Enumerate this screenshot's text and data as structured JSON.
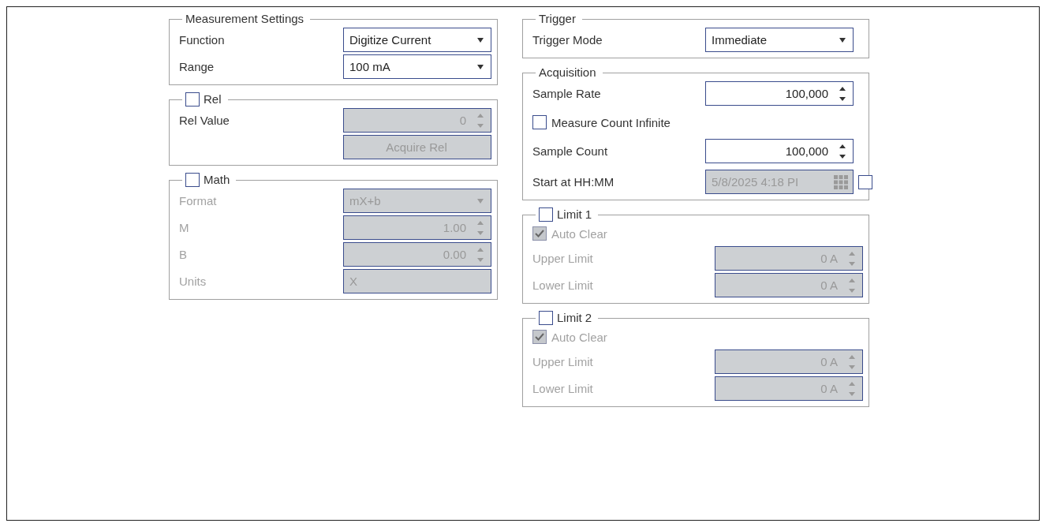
{
  "columns": [
    {
      "groups": [
        {
          "title": "Measurement Settings",
          "disabled": false,
          "rows": [
            {
              "kind": "select",
              "label": "Function",
              "value": "Digitize Current",
              "disabled": false
            },
            {
              "kind": "select",
              "label": "Range",
              "value": "100 mA",
              "disabled": false
            }
          ]
        },
        {
          "title": "Rel",
          "checkbox": {
            "checked": false
          },
          "disabled": false,
          "rows": [
            {
              "kind": "spin",
              "label": "Rel Value",
              "value": "0",
              "disabled": true
            },
            {
              "kind": "button",
              "text": "Acquire Rel",
              "disabled": true
            }
          ]
        },
        {
          "title": "Math",
          "checkbox": {
            "checked": false
          },
          "disabled": true,
          "rows": [
            {
              "kind": "select",
              "label": "Format",
              "value": "mX+b",
              "disabled": true
            },
            {
              "kind": "spin",
              "label": "M",
              "value": "1.00",
              "disabled": true
            },
            {
              "kind": "spin",
              "label": "B",
              "value": "0.00",
              "disabled": true
            },
            {
              "kind": "text",
              "label": "Units",
              "value": "X",
              "disabled": true
            }
          ]
        }
      ]
    },
    {
      "groups": [
        {
          "title": "Trigger",
          "disabled": false,
          "rows": [
            {
              "kind": "select",
              "label": "Trigger Mode",
              "value": "Immediate",
              "disabled": false
            }
          ]
        },
        {
          "title": "Acquisition",
          "disabled": false,
          "rows": [
            {
              "kind": "spin",
              "label": "Sample Rate",
              "value": "100,000",
              "disabled": false
            },
            {
              "kind": "check",
              "label": "Measure Count Infinite",
              "checked": false,
              "disabled": false
            },
            {
              "kind": "spin",
              "label": "Sample Count",
              "value": "100,000",
              "disabled": false
            },
            {
              "kind": "datetime",
              "label": "Start at HH:MM",
              "value": "5/8/2025 4:18 PI",
              "disabled": true,
              "checked": false
            }
          ]
        },
        {
          "title": "Limit 1",
          "checkbox": {
            "checked": false
          },
          "disabled": true,
          "rows": [
            {
              "kind": "check",
              "label": "Auto Clear",
              "checked": true,
              "disabled": true
            },
            {
              "kind": "spin",
              "label": "Upper Limit",
              "value": "0 A",
              "disabled": true
            },
            {
              "kind": "spin",
              "label": "Lower Limit",
              "value": "0 A",
              "disabled": true
            }
          ]
        },
        {
          "title": "Limit 2",
          "checkbox": {
            "checked": false
          },
          "disabled": true,
          "rows": [
            {
              "kind": "check",
              "label": "Auto Clear",
              "checked": true,
              "disabled": true
            },
            {
              "kind": "spin",
              "label": "Upper Limit",
              "value": "0 A",
              "disabled": true
            },
            {
              "kind": "spin",
              "label": "Lower Limit",
              "value": "0 A",
              "disabled": true
            }
          ]
        }
      ]
    }
  ]
}
